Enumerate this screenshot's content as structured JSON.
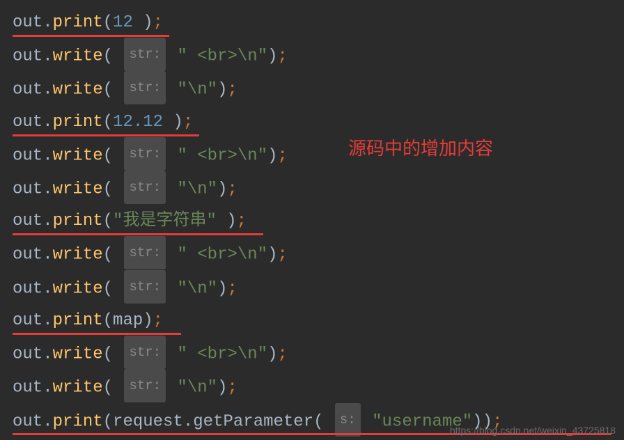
{
  "code": {
    "out": "out",
    "dot": ".",
    "print": "print",
    "write": "write",
    "open": "(",
    "close": ")",
    "semi": ";",
    "comma": ",",
    "num12": "12",
    "num1212": "12.12",
    "map": "map",
    "request": "request",
    "getParameter": "getParameter",
    "hint_str": "str:",
    "hint_s": "s:",
    "str_br": "\" <br>\\n\"",
    "str_n": "\"\\n\"",
    "str_chinese": "\"我是字符串\"",
    "str_username": "\"username\"",
    "space": " "
  },
  "annotation": {
    "text": "源码中的增加内容"
  },
  "watermark": {
    "text": "https://blog.csdn.net/weixin_43725818"
  }
}
